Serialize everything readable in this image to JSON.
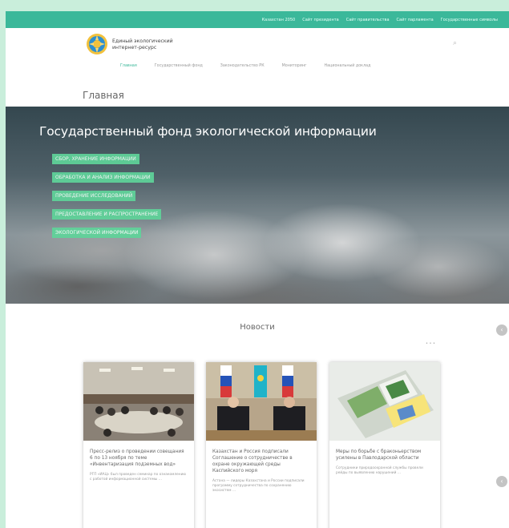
{
  "topbar": {
    "links": [
      "Казахстан 2050",
      "Сайт президента",
      "Сайт правительства",
      "Сайт парламента",
      "Государственные символы"
    ]
  },
  "header": {
    "logo_line1": "Единый экологический",
    "logo_line2": "интернет-ресурс"
  },
  "nav": {
    "items": [
      "Главная",
      "Государственный фонд",
      "Законодательство РК",
      "Мониторинг",
      "Национальный доклад"
    ]
  },
  "page_title": "Главная",
  "hero": {
    "title": "Государственный фонд экологической информации",
    "tags": [
      "СБОР, ХРАНЕНИЕ ИНФОРМАЦИИ",
      "ОБРАБОТКА И АНАЛИЗ ИНФОРМАЦИИ",
      "ПРОВЕДЕНИЕ ИССЛЕДОВАНИЙ",
      "ПРЕДОСТАВЛЕНИЕ И РАСПРОСТРАНЕНИЕ",
      "ЭКОЛОГИЧЕСКОЙ ИНФОРМАЦИИ"
    ]
  },
  "news": {
    "title": "Новости",
    "cards": [
      {
        "title": "Пресс-релиз о проведении совещания 6 по 13 ноября по теме «Инвентаризация подземных вод»",
        "text": "РГП «ИАЦ» был проведен семинар по ознакомлению с работой информационной системы …"
      },
      {
        "title": "Казахстан и Россия подписали Соглашение о сотрудничестве в охране окружающей среды Каспийского моря",
        "text": "Астана — лидеры Казахстана и России подписали программу сотрудничества по сохранению экосистем …"
      },
      {
        "title": "Меры по борьбе с браконьерством усилены в Павлодарской области",
        "text": "Сотрудники природоохранной службы провели рейды по выявлению нарушений …"
      }
    ]
  },
  "colors": {
    "accent": "#3bb89a",
    "tag": "#5fd49a",
    "background": "#c9eedb"
  }
}
